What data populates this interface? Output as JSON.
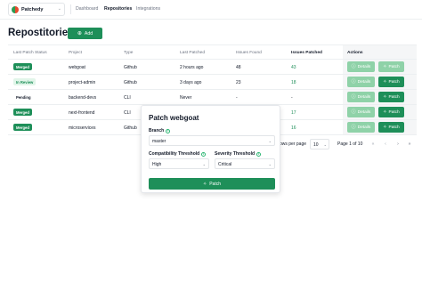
{
  "org": {
    "name": "Patchedy",
    "logo_icon": "patchedy-logo-icon"
  },
  "nav": {
    "items": [
      "Dashboard",
      "Repositories",
      "Integrations"
    ],
    "active": "Repositories"
  },
  "header": {
    "title": "Repostitories",
    "add_label": "Add",
    "add_icon": "plus-icon"
  },
  "table": {
    "columns": [
      "Last Patch Status",
      "Project",
      "Type",
      "Last Patched",
      "Issues Found",
      "Issues Patched",
      "Actions"
    ],
    "rows": [
      {
        "status": "Merged",
        "project": "webgoat",
        "type": "Github",
        "last_patched": "2 hours ago",
        "issues_found": "48",
        "issues_patched": "43",
        "details": "Details",
        "patch": "Patch"
      },
      {
        "status": "In Review",
        "project": "project-admin",
        "type": "Github",
        "last_patched": "3 days ago",
        "issues_found": "23",
        "issues_patched": "18",
        "details": "Details",
        "patch": "Patch"
      },
      {
        "status": "Pending",
        "project": "backend-devs",
        "type": "CLI",
        "last_patched": "Never",
        "issues_found": "-",
        "issues_patched": "-",
        "details": "Details",
        "patch": "Patch"
      },
      {
        "status": "Merged",
        "project": "next-frontend",
        "type": "CLI",
        "last_patched": "",
        "issues_found": "",
        "issues_patched": "17",
        "details": "Details",
        "patch": "Patch"
      },
      {
        "status": "Merged",
        "project": "microservices",
        "type": "Github",
        "last_patched": "",
        "issues_found": "",
        "issues_patched": "16",
        "details": "Details",
        "patch": "Patch"
      }
    ]
  },
  "pagination": {
    "rows_per_page_label": "ows per page",
    "rows_per_page": "10",
    "page_label": "Page 1 of 10",
    "buttons": [
      "«",
      "‹",
      "›",
      "»"
    ]
  },
  "popover": {
    "title": "Patch webgoat",
    "branch_label": "Branch",
    "branch_value": "master",
    "compat_label": "Compatibility Threshold",
    "compat_value": "High",
    "severity_label": "Severity Threshold",
    "severity_value": "Critical",
    "patch_label": "Patch"
  },
  "colors": {
    "accent": "#1e8f59",
    "accent_light": "#8fd2a8",
    "badge_review_bg": "#e1f5e9"
  }
}
